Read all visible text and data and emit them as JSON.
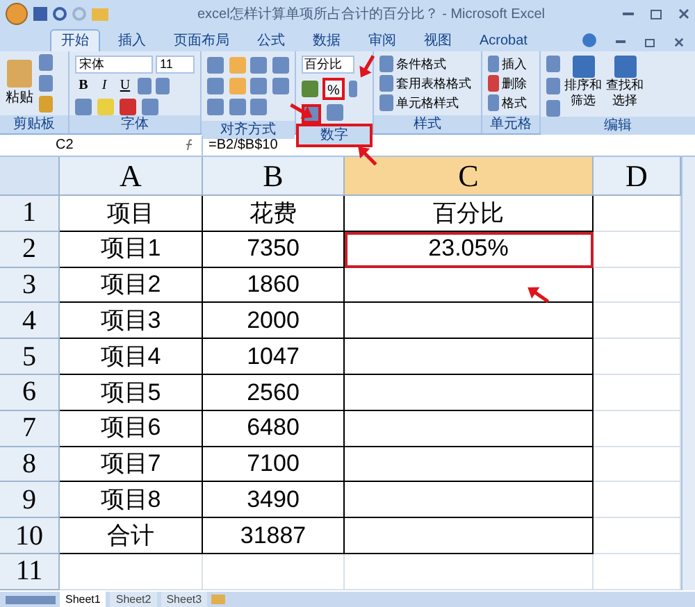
{
  "window": {
    "title": "excel怎样计算单项所占合计的百分比？ - Microsoft Excel"
  },
  "tabs": [
    {
      "label": "开始",
      "selected": true
    },
    {
      "label": "插入",
      "selected": false
    },
    {
      "label": "页面布局",
      "selected": false
    },
    {
      "label": "公式",
      "selected": false
    },
    {
      "label": "数据",
      "selected": false
    },
    {
      "label": "审阅",
      "selected": false
    },
    {
      "label": "视图",
      "selected": false
    },
    {
      "label": "Acrobat",
      "selected": false
    }
  ],
  "ribbon": {
    "clipboard": {
      "paste": "粘贴",
      "label": "剪贴板"
    },
    "font": {
      "name": "宋体",
      "size": "11",
      "buttons": [
        "B",
        "I",
        "U"
      ],
      "label": "字体"
    },
    "alignment": {
      "label": "对齐方式"
    },
    "number": {
      "format": "百分比",
      "percent": "%",
      "label": "数字"
    },
    "styles": {
      "items": [
        "条件格式",
        "套用表格格式",
        "单元格样式"
      ],
      "label": "样式"
    },
    "cells": {
      "items": [
        "插入",
        "删除",
        "格式"
      ],
      "label": "单元格"
    },
    "editing": {
      "sort": [
        "排序和",
        "筛选"
      ],
      "find": [
        "查找和",
        "选择"
      ],
      "label": "编辑"
    }
  },
  "formula_bar": {
    "name_box": "C2",
    "formula": "=B2/$B$10"
  },
  "columns": [
    {
      "label": "A",
      "selected": false
    },
    {
      "label": "B",
      "selected": false
    },
    {
      "label": "C",
      "selected": true
    },
    {
      "label": "D",
      "selected": false
    }
  ],
  "rows": [
    {
      "number": "1",
      "cells": [
        "项目",
        "花费",
        "百分比"
      ]
    },
    {
      "number": "2",
      "cells": [
        "项目1",
        "7350",
        "23.05%"
      ],
      "selected": true
    },
    {
      "number": "3",
      "cells": [
        "项目2",
        "1860",
        ""
      ]
    },
    {
      "number": "4",
      "cells": [
        "项目3",
        "2000",
        ""
      ]
    },
    {
      "number": "5",
      "cells": [
        "项目4",
        "1047",
        ""
      ]
    },
    {
      "number": "6",
      "cells": [
        "项目5",
        "2560",
        ""
      ]
    },
    {
      "number": "7",
      "cells": [
        "项目6",
        "6480",
        ""
      ]
    },
    {
      "number": "8",
      "cells": [
        "项目7",
        "7100",
        ""
      ]
    },
    {
      "number": "9",
      "cells": [
        "项目8",
        "3490",
        ""
      ]
    },
    {
      "number": "10",
      "cells": [
        "合计",
        "31887",
        ""
      ]
    },
    {
      "number": "11",
      "cells": []
    }
  ],
  "sheets": [
    {
      "label": "Sheet1",
      "selected": true
    },
    {
      "label": "Sheet2",
      "selected": false
    },
    {
      "label": "Sheet3",
      "selected": false
    }
  ]
}
